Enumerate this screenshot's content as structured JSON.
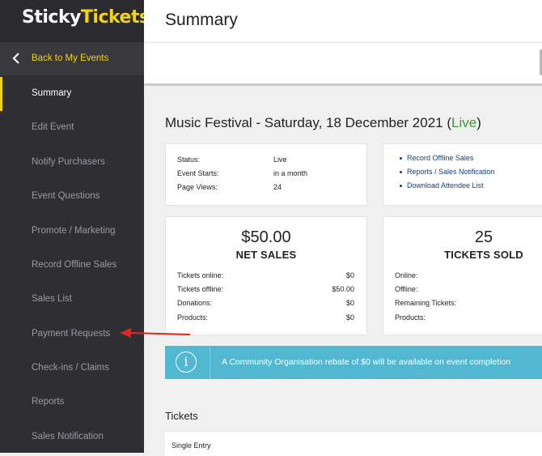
{
  "brand": {
    "part1": "Sticky",
    "part2": "Tickets",
    "accent": "#f1d310"
  },
  "sidebar": {
    "back_label": "Back to My Events",
    "items": [
      {
        "label": "Summary",
        "active": true
      },
      {
        "label": "Edit Event"
      },
      {
        "label": "Notify Purchasers"
      },
      {
        "label": "Event Questions"
      },
      {
        "label": "Promote / Marketing"
      },
      {
        "label": "Record Offline Sales"
      },
      {
        "label": "Sales List"
      },
      {
        "label": "Payment Requests"
      },
      {
        "label": "Check-ins / Claims"
      },
      {
        "label": "Reports"
      },
      {
        "label": "Sales Notification"
      }
    ]
  },
  "header": {
    "title": "Summary"
  },
  "event": {
    "title": "Music Festival - Saturday, 18 December 2021",
    "status_open": "(",
    "status_word": "Live",
    "status_close": ")",
    "status_color": "#3c9a2e"
  },
  "info": {
    "rows": [
      {
        "label": "Status:",
        "value": "Live"
      },
      {
        "label": "Event Starts:",
        "value": "in a month"
      },
      {
        "label": "Page Views:",
        "value": "24"
      }
    ]
  },
  "quick_links": [
    "Record Offline Sales",
    "Reports / Sales Notification",
    "Download Attendee List"
  ],
  "net_sales": {
    "amount": "$50.00",
    "label": "NET SALES",
    "rows": [
      {
        "label": "Tickets online:",
        "value": "$0"
      },
      {
        "label": "Tickets offline:",
        "value": "$50.00"
      },
      {
        "label": "Donations:",
        "value": "$0"
      },
      {
        "label": "Products:",
        "value": "$0"
      }
    ]
  },
  "tickets_sold": {
    "count": "25",
    "label": "TICKETS SOLD",
    "rows": [
      {
        "label": "Online:"
      },
      {
        "label": "Offline:"
      },
      {
        "label": "Remaining Tickets:"
      },
      {
        "label": "Products:"
      }
    ]
  },
  "banner": {
    "icon": "info-icon",
    "icon_glyph": "i",
    "text": "A Community Organisation rebate of $0 will be available on event completion",
    "color": "#52b7d0"
  },
  "tickets_section": {
    "title": "Tickets",
    "first_row": "Single Entry"
  }
}
